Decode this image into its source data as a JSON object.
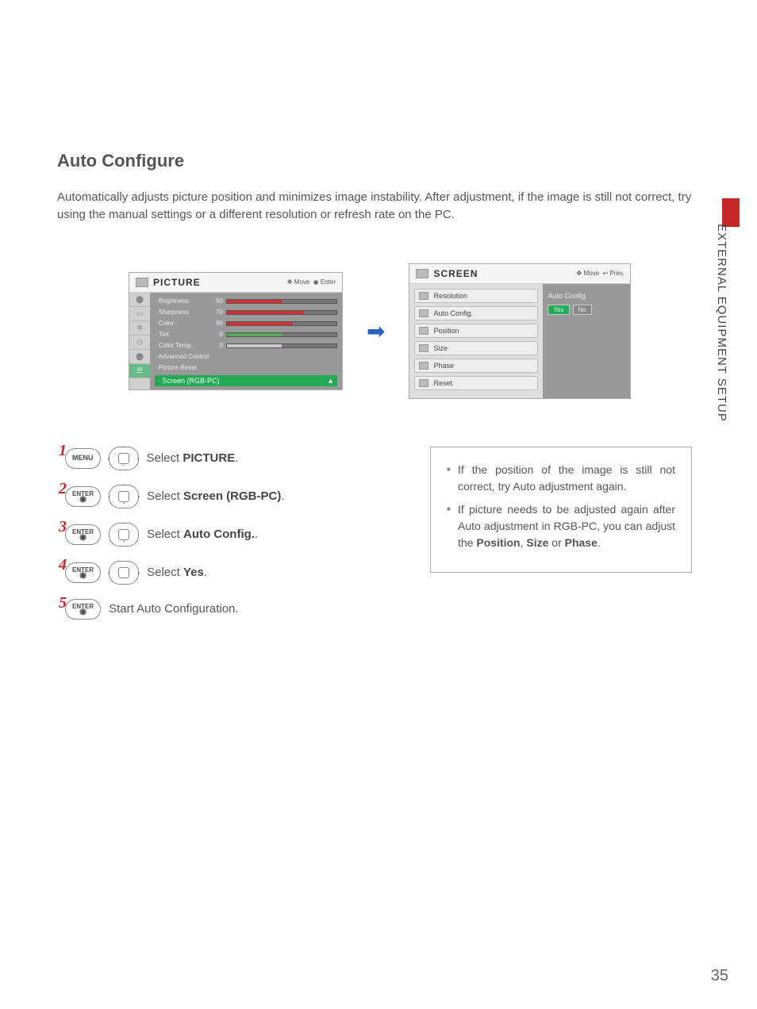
{
  "section_side_label": "EXTERNAL EQUIPMENT SETUP",
  "page_number": "35",
  "title": "Auto Configure",
  "intro": "Automatically adjusts picture position and minimizes image instability. After adjustment, if the image is still not correct, try using the manual settings or a different resolution or refresh rate on the PC.",
  "osd_picture": {
    "title": "PICTURE",
    "hints_move": "Move",
    "hints_enter": "Enter",
    "items": [
      {
        "label": "· Brightness",
        "value": "50",
        "fill": 50
      },
      {
        "label": "· Sharpness",
        "value": "70",
        "fill": 70
      },
      {
        "label": "· Color",
        "value": "60",
        "fill": 60
      },
      {
        "label": "· Tint",
        "value": "0",
        "fill": 50
      },
      {
        "label": "· Color Temp.",
        "value": "0",
        "fill": 50
      },
      {
        "label": "· Advanced Control",
        "value": "",
        "fill": null
      },
      {
        "label": "· Picture Reset",
        "value": "",
        "fill": null
      }
    ],
    "selected": "· Screen (RGB-PC)"
  },
  "osd_screen": {
    "title": "SCREEN",
    "hints_move": "Move",
    "hints_prev": "Prev.",
    "items": [
      "Resolution",
      "Auto Config.",
      "Position",
      "Size",
      "Phase",
      "Reset"
    ],
    "right_label": "Auto Config.",
    "yes": "Yes",
    "no": "No"
  },
  "steps": [
    {
      "num": "1",
      "key": "MENU",
      "nav": "lr",
      "text_pre": "Select ",
      "bold": "PICTURE",
      "text_post": "."
    },
    {
      "num": "2",
      "key": "ENTER",
      "nav": "udlr",
      "text_pre": "Select ",
      "bold": "Screen (RGB-PC)",
      "text_post": "."
    },
    {
      "num": "3",
      "key": "ENTER",
      "nav": "ud",
      "text_pre": "Select ",
      "bold": "Auto Config.",
      "text_post": "."
    },
    {
      "num": "4",
      "key": "ENTER",
      "nav": "lr",
      "text_pre": "Select ",
      "bold": "Yes",
      "text_post": "."
    },
    {
      "num": "5",
      "key": "ENTER",
      "nav": null,
      "text_pre": "Start Auto Configuration.",
      "bold": "",
      "text_post": ""
    }
  ],
  "tips": {
    "t1_a": "If the position of the image is still not correct, try Auto adjustment again.",
    "t2_a": "If picture needs to be adjusted again after Auto adjustment in RGB-PC, you can adjust the ",
    "t2_b1": "Position",
    "t2_c1": ", ",
    "t2_b2": "Size",
    "t2_c2": " or ",
    "t2_b3": "Phase",
    "t2_c3": "."
  }
}
